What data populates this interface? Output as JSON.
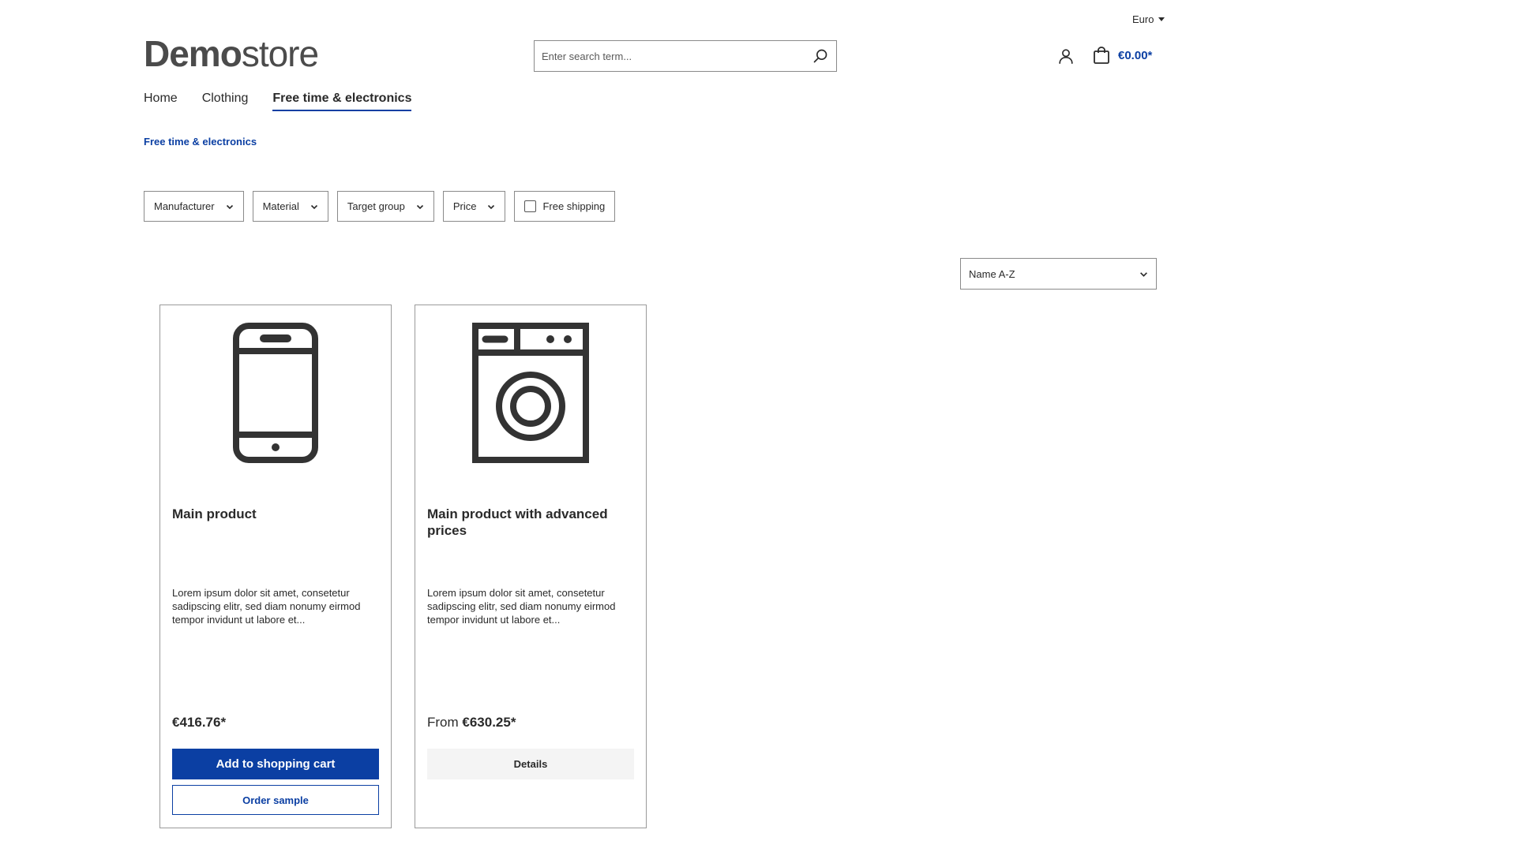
{
  "header": {
    "currency": "Euro",
    "logo_bold": "Demo",
    "logo_light": "store",
    "search_placeholder": "Enter search term...",
    "cart_total": "€0.00*"
  },
  "nav": {
    "items": [
      {
        "label": "Home",
        "active": false
      },
      {
        "label": "Clothing",
        "active": false
      },
      {
        "label": "Free time & electronics",
        "active": true
      }
    ]
  },
  "breadcrumb": "Free time & electronics",
  "filters": {
    "manufacturer": "Manufacturer",
    "material": "Material",
    "target_group": "Target group",
    "price": "Price",
    "free_shipping": "Free shipping"
  },
  "sort": {
    "selected": "Name A-Z"
  },
  "products": [
    {
      "title": "Main product",
      "description": "Lorem ipsum dolor sit amet, consetetur sadipscing elitr, sed diam nonumy eirmod tempor invidunt ut labore et...",
      "price_prefix": "",
      "price": "€416.76*",
      "primary_button": "Add to shopping cart",
      "secondary_button": "Order sample",
      "icon": "smartphone-icon"
    },
    {
      "title": "Main product with advanced prices",
      "description": "Lorem ipsum dolor sit amet, consetetur sadipscing elitr, sed diam nonumy eirmod tempor invidunt ut labore et...",
      "price_prefix": "From ",
      "price": "€630.25*",
      "primary_button": "Details",
      "icon": "washing-machine-icon"
    }
  ],
  "colors": {
    "accent": "#0b3fa3",
    "text": "#2a2a2a",
    "icon": "#333333"
  }
}
